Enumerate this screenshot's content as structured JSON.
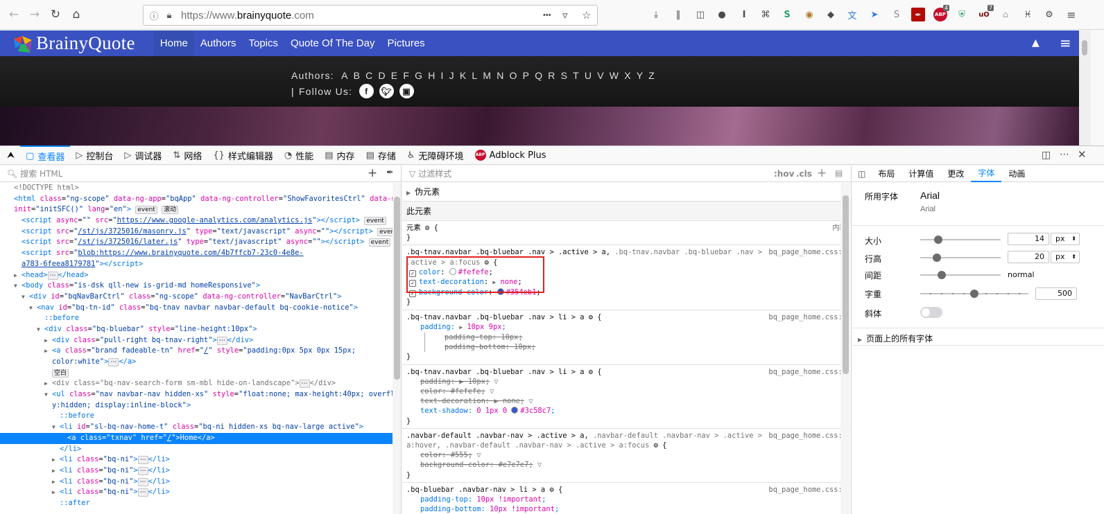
{
  "browser": {
    "url_prefix": "https://www.",
    "url_domain": "brainyquote",
    "url_suffix": ".com",
    "url_more": "•••",
    "badges": {
      "abp": "4",
      "ub": "7"
    }
  },
  "site": {
    "logo_text": "BrainyQuote",
    "nav": [
      "Home",
      "Authors",
      "Topics",
      "Quote Of The Day",
      "Pictures"
    ],
    "authors_label": "Authors:",
    "letters": [
      "A",
      "B",
      "C",
      "D",
      "E",
      "F",
      "G",
      "H",
      "I",
      "J",
      "K",
      "L",
      "M",
      "N",
      "O",
      "P",
      "Q",
      "R",
      "S",
      "T",
      "U",
      "V",
      "W",
      "X",
      "Y",
      "Z"
    ],
    "follow_label": "Follow Us:",
    "social": [
      "f",
      "t",
      "ig"
    ]
  },
  "devtools": {
    "tabs": [
      "查看器",
      "控制台",
      "调试器",
      "网络",
      "样式编辑器",
      "性能",
      "内存",
      "存储",
      "无障碍环境",
      "Adblock Plus"
    ],
    "search_html_placeholder": "搜索 HTML",
    "filter_placeholder": "过滤样式",
    "hov": ":hov",
    "cls": ".cls",
    "pseudo_elements": "伪元素",
    "this_element": "此元素",
    "element_label": "元素",
    "inline": "内联",
    "right_tabs": [
      "布局",
      "计算值",
      "更改",
      "字体",
      "动画"
    ],
    "fonts": {
      "used_label": "所用字体",
      "used_font": "Arial",
      "used_font_sub": "Arial",
      "size_label": "大小",
      "size_value": "14",
      "size_unit": "px",
      "line_height_label": "行高",
      "line_height_value": "20",
      "line_height_unit": "px",
      "spacing_label": "间距",
      "spacing_value": "normal",
      "weight_label": "字重",
      "weight_value": "500",
      "italic_label": "斜体",
      "all_fonts_label": "页面上的所有字体"
    }
  }
}
